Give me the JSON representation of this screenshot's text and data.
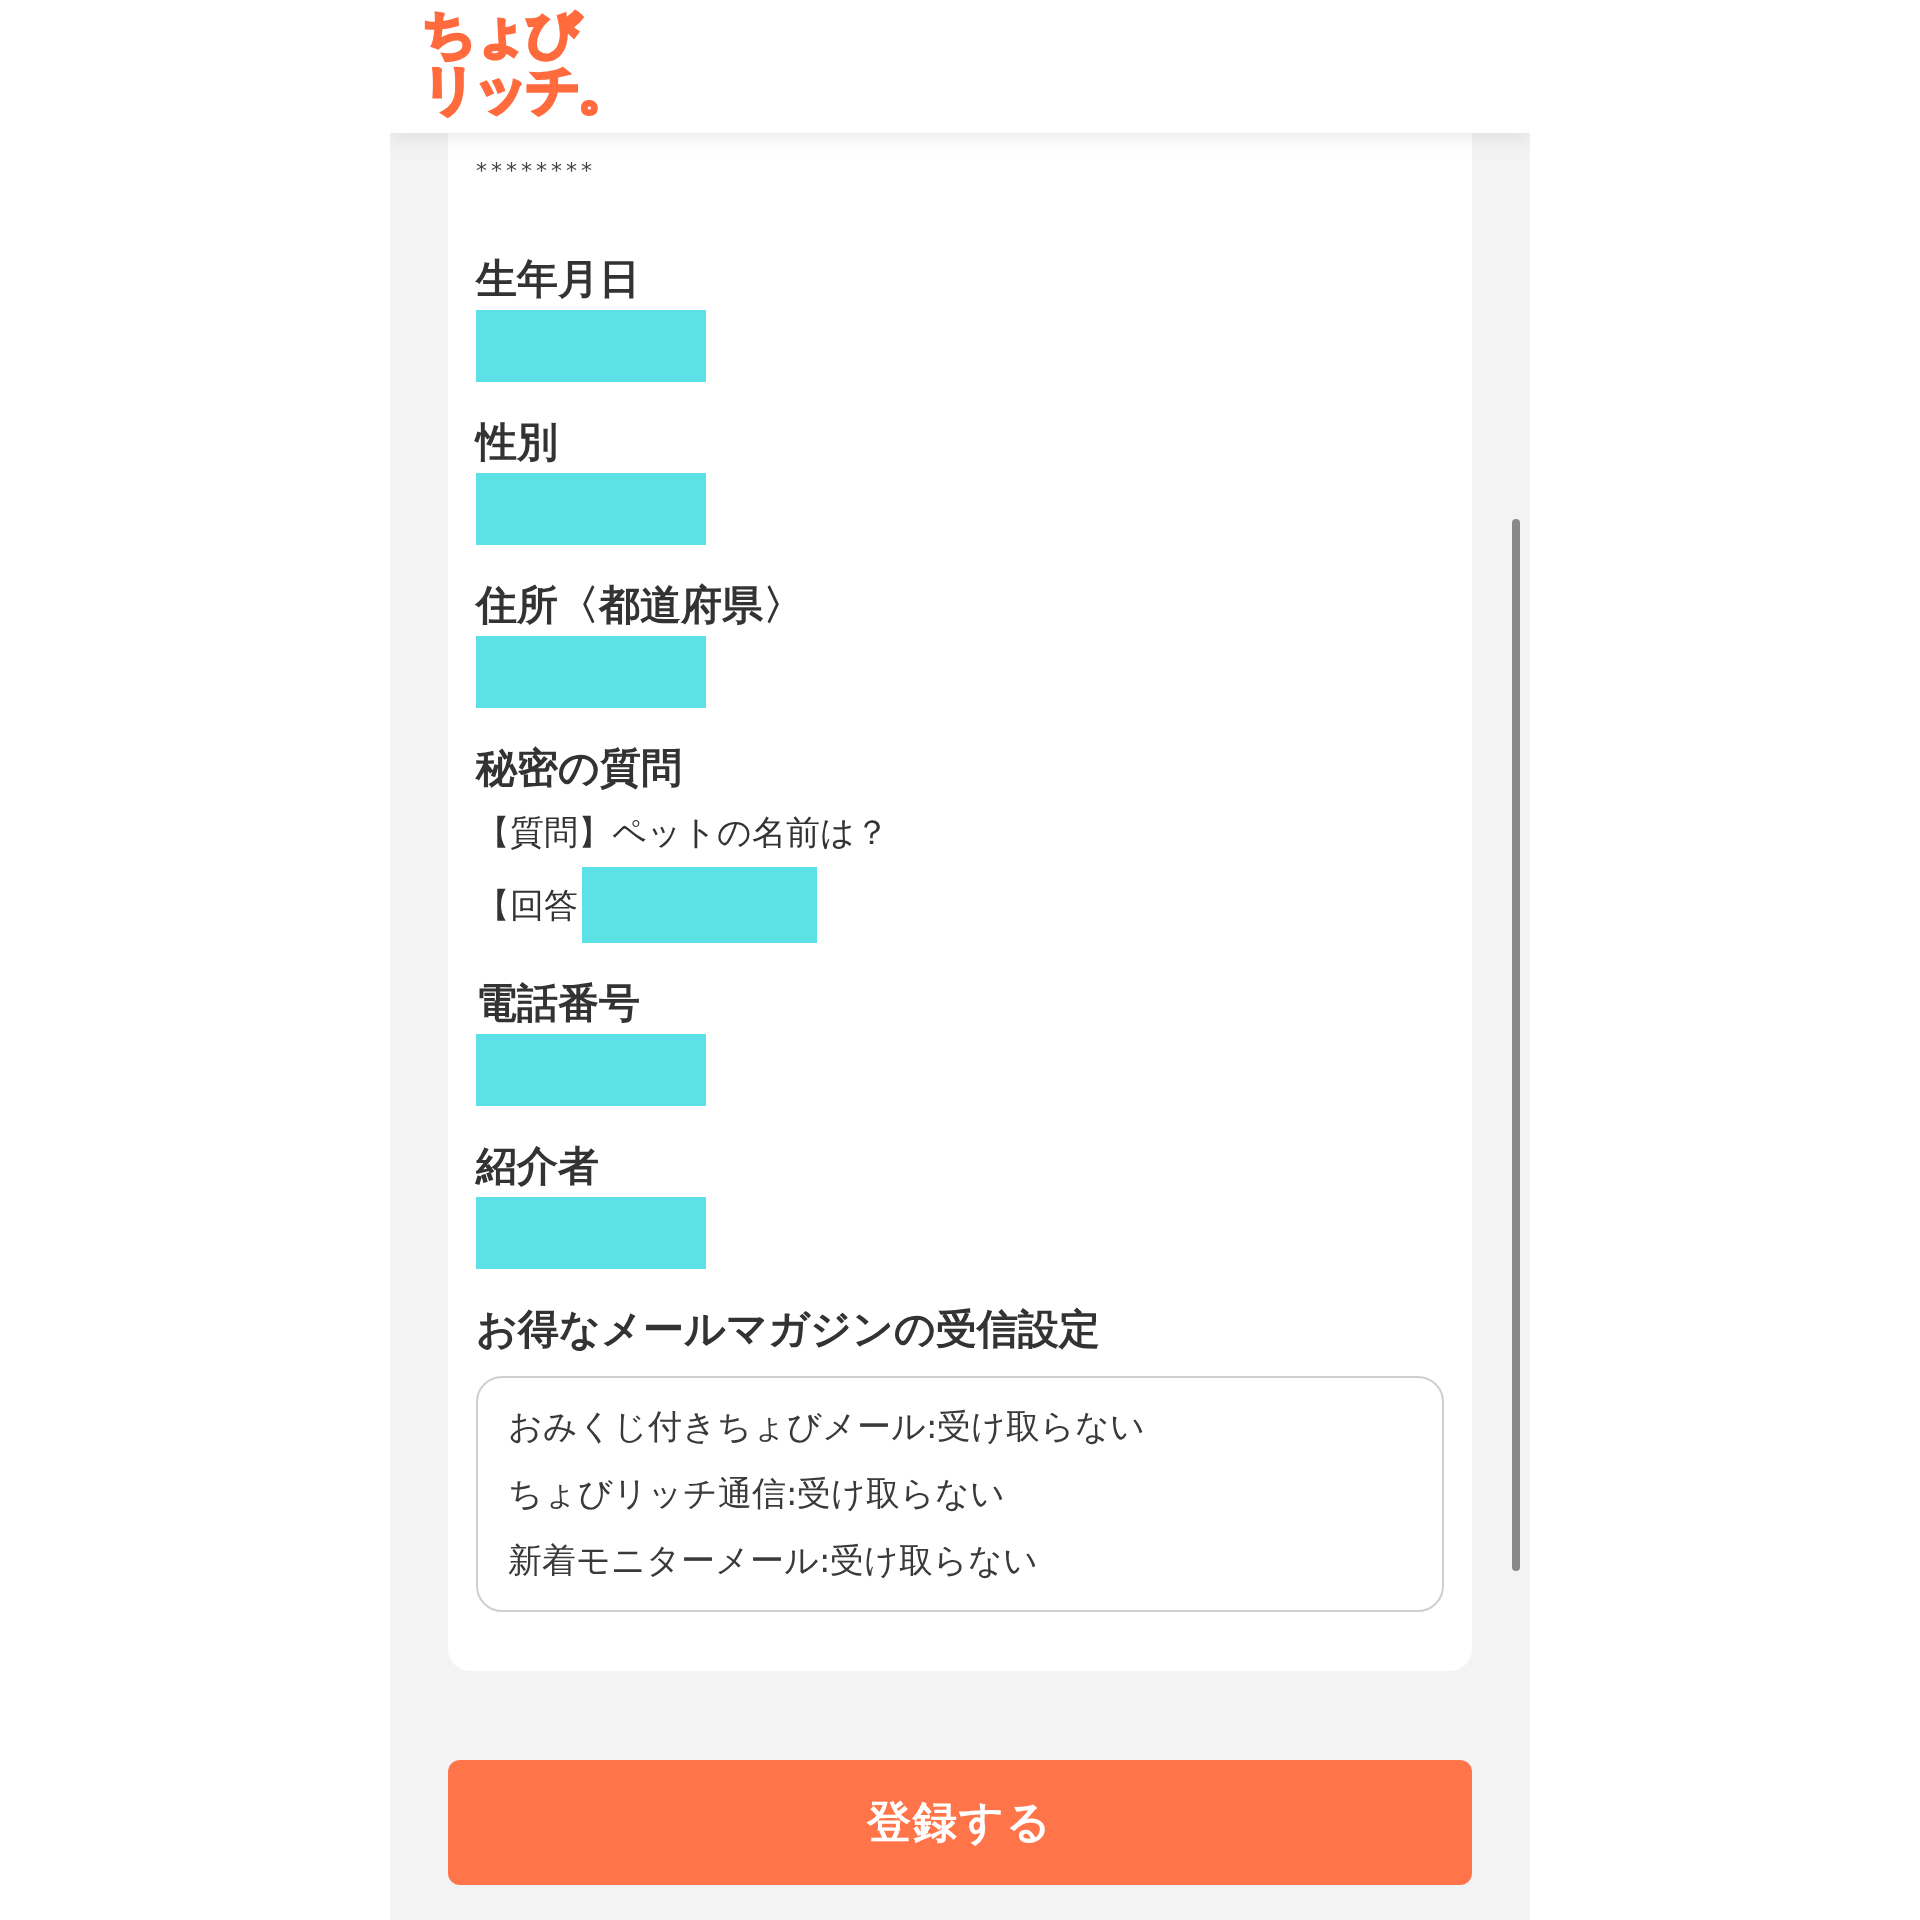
{
  "header": {
    "logo": [
      "ちょび",
      "リッチ。"
    ]
  },
  "form": {
    "password_value": "********",
    "sections": [
      {
        "kind": "field",
        "label": "生年月日",
        "redacted": true
      },
      {
        "kind": "field",
        "label": "性別",
        "redacted": true
      },
      {
        "kind": "field",
        "label": "住所〈都道府県〉",
        "redacted": true
      },
      {
        "kind": "question",
        "label": "秘密の質問",
        "question": "【質問】ペットの名前は？",
        "answer_label": "【回答",
        "redacted": true
      },
      {
        "kind": "field",
        "label": "電話番号",
        "redacted": true
      },
      {
        "kind": "field",
        "label": "紹介者",
        "redacted": true
      },
      {
        "kind": "list",
        "label": "お得なメールマガジンの受信設定",
        "lines": [
          "おみくじ付きちょびメール:受け取らない",
          "ちょびリッチ通信:受け取らない",
          "新着モニターメール:受け取らない"
        ]
      }
    ]
  },
  "submit_button": {
    "label": "登録する"
  }
}
